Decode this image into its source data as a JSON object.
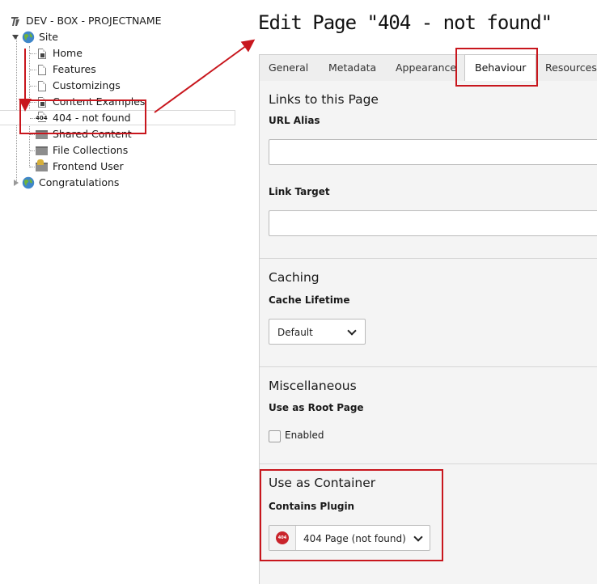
{
  "tree": {
    "root_label": "DEV - BOX - PROJECTNAME",
    "root_icon": "typo3-logo-icon",
    "site_label": "Site",
    "pages": [
      {
        "label": "Home",
        "icon": "page-shortcut-icon"
      },
      {
        "label": "Features",
        "icon": "page-icon"
      },
      {
        "label": "Customizings",
        "icon": "page-icon"
      },
      {
        "label": "Content Examples",
        "icon": "page-shortcut-icon"
      },
      {
        "label": "404 - not found",
        "icon": "page-404-icon"
      },
      {
        "label": "Shared Content",
        "icon": "folder-icon"
      },
      {
        "label": "File Collections",
        "icon": "folder-icon"
      },
      {
        "label": "Frontend User",
        "icon": "frontend-user-folder-icon"
      }
    ],
    "congrats_label": "Congratulations",
    "page_404_badge": "404"
  },
  "editor": {
    "title": "Edit Page \"404 - not found\"",
    "tabs": [
      "General",
      "Metadata",
      "Appearance",
      "Behaviour",
      "Resources"
    ],
    "active_tab": "Behaviour",
    "sections": {
      "links": {
        "heading": "Links to this Page",
        "url_alias_label": "URL Alias",
        "url_alias_value": "",
        "link_target_label": "Link Target",
        "link_target_value": ""
      },
      "caching": {
        "heading": "Caching",
        "cache_lifetime_label": "Cache Lifetime",
        "cache_lifetime_value": "Default"
      },
      "misc": {
        "heading": "Miscellaneous",
        "root_page_label": "Use as Root Page",
        "enabled_label": "Enabled",
        "enabled_checked": false
      },
      "container": {
        "heading": "Use as Container",
        "contains_plugin_label": "Contains Plugin",
        "contains_plugin_value": "404 Page (not found)",
        "plugin_icon_text": "404"
      }
    }
  },
  "colors": {
    "annotation_red": "#c8161d",
    "plugin_icon_red": "#c9242b",
    "tab_bar_bg": "#eeeeee",
    "form_bg": "#f4f4f4"
  }
}
